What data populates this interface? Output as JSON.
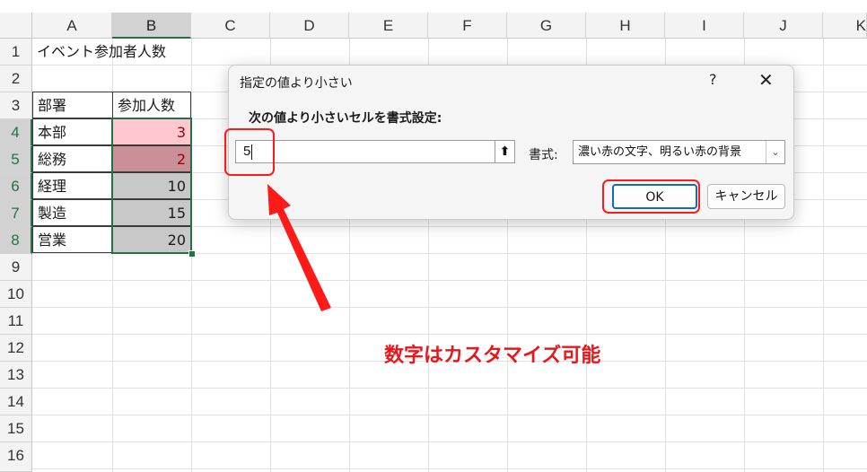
{
  "columns": [
    "A",
    "B",
    "C",
    "D",
    "E",
    "F",
    "G",
    "H",
    "I",
    "J",
    "K"
  ],
  "rows": [
    "1",
    "2",
    "3",
    "4",
    "5",
    "6",
    "7",
    "8",
    "9",
    "10",
    "11",
    "12",
    "13",
    "14",
    "15",
    "16"
  ],
  "cells": {
    "a1": "イベント参加者人数",
    "a3": "部署",
    "b3": "参加人数",
    "table": [
      {
        "dept": "本部",
        "count": "3"
      },
      {
        "dept": "総務",
        "count": "2"
      },
      {
        "dept": "経理",
        "count": "10"
      },
      {
        "dept": "製造",
        "count": "15"
      },
      {
        "dept": "営業",
        "count": "20"
      }
    ]
  },
  "dialog": {
    "title": "指定の値より小さい",
    "help": "?",
    "close": "✕",
    "label": "次の値より小さいセルを書式設定:",
    "value": "5",
    "ref_icon": "⬆",
    "format_label": "書式:",
    "format_value": "濃い赤の文字、明るい赤の背景",
    "format_arrow": "⌄",
    "ok": "OK",
    "cancel": "キャンセル"
  },
  "annotation": "数字はカスタマイズ可能",
  "colors": {
    "accent": "#217346",
    "highlight_red": "#ff1a1a",
    "annotation_red": "#e8171b"
  }
}
